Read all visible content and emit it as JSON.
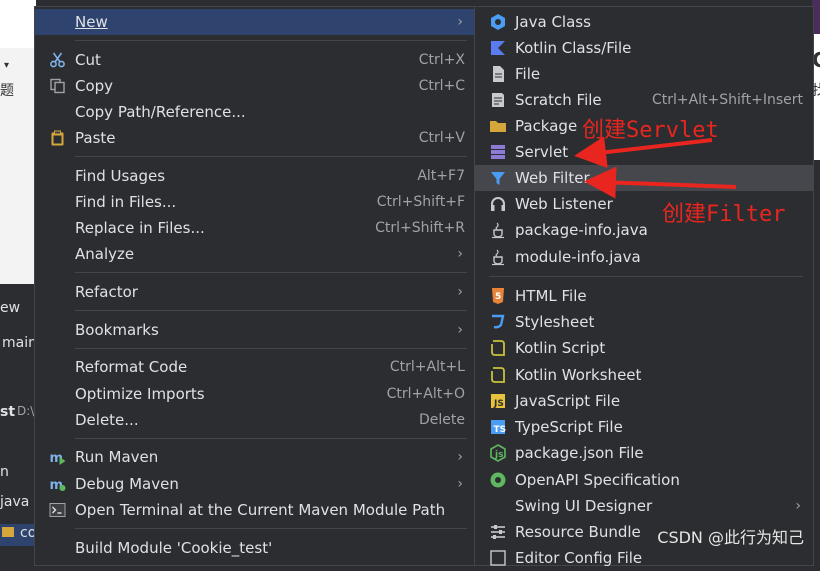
{
  "background": {
    "left_texts": [
      "题",
      "ew",
      "main",
      "st",
      "D:\\",
      "n",
      "java",
      "co"
    ],
    "right_texts": [
      "C",
      "找"
    ]
  },
  "menu": {
    "items": [
      {
        "label": "New",
        "arrow": "›",
        "icon": "none",
        "highlight": true
      },
      {
        "label": "Cut",
        "shortcut": "Ctrl+X",
        "icon": "scissors-icon"
      },
      {
        "label": "Copy",
        "shortcut": "Ctrl+C",
        "icon": "copy-icon"
      },
      {
        "label": "Copy Path/Reference...",
        "icon": "none"
      },
      {
        "label": "Paste",
        "shortcut": "Ctrl+V",
        "icon": "clipboard-icon"
      },
      {
        "label": "Find Usages",
        "shortcut": "Alt+F7"
      },
      {
        "label": "Find in Files...",
        "shortcut": "Ctrl+Shift+F"
      },
      {
        "label": "Replace in Files...",
        "shortcut": "Ctrl+Shift+R"
      },
      {
        "label": "Analyze",
        "arrow": "›"
      },
      {
        "label": "Refactor",
        "arrow": "›"
      },
      {
        "label": "Bookmarks",
        "arrow": "›"
      },
      {
        "label": "Reformat Code",
        "shortcut": "Ctrl+Alt+L"
      },
      {
        "label": "Optimize Imports",
        "shortcut": "Ctrl+Alt+O"
      },
      {
        "label": "Delete...",
        "shortcut": "Delete"
      },
      {
        "label": "Run Maven",
        "arrow": "›",
        "icon": "maven-run-icon"
      },
      {
        "label": "Debug Maven",
        "arrow": "›",
        "icon": "maven-debug-icon"
      },
      {
        "label": "Open Terminal at the Current Maven Module Path",
        "icon": "terminal-icon"
      },
      {
        "label": "Build Module 'Cookie_test'"
      }
    ]
  },
  "submenu": {
    "items": [
      {
        "label": "Java Class",
        "icon": "java-class-icon"
      },
      {
        "label": "Kotlin Class/File",
        "icon": "kotlin-icon"
      },
      {
        "label": "File",
        "icon": "file-icon"
      },
      {
        "label": "Scratch File",
        "shortcut": "Ctrl+Alt+Shift+Insert",
        "icon": "scratch-file-icon"
      },
      {
        "label": "Package",
        "icon": "folder-icon"
      },
      {
        "label": "Servlet",
        "icon": "servlet-icon"
      },
      {
        "label": "Web Filter",
        "icon": "filter-icon",
        "highlight": true
      },
      {
        "label": "Web Listener",
        "icon": "headphones-icon"
      },
      {
        "label": "package-info.java",
        "icon": "java-cup-icon"
      },
      {
        "label": "module-info.java",
        "icon": "java-cup-icon"
      },
      {
        "label": "HTML File",
        "icon": "html5-icon"
      },
      {
        "label": "Stylesheet",
        "icon": "css3-icon"
      },
      {
        "label": "Kotlin Script",
        "icon": "kotlin-script-icon"
      },
      {
        "label": "Kotlin Worksheet",
        "icon": "kotlin-worksheet-icon"
      },
      {
        "label": "JavaScript File",
        "icon": "javascript-icon"
      },
      {
        "label": "TypeScript File",
        "icon": "typescript-icon"
      },
      {
        "label": "package.json File",
        "icon": "nodejs-icon"
      },
      {
        "label": "OpenAPI Specification",
        "icon": "openapi-icon"
      },
      {
        "label": "Swing UI Designer",
        "arrow": "›"
      },
      {
        "label": "Resource Bundle",
        "icon": "resource-bundle-icon"
      },
      {
        "label": "Editor Config File",
        "icon": "editor-config-icon"
      }
    ]
  },
  "annotations": {
    "servlet": "创建Servlet",
    "filter": "创建Filter"
  },
  "watermark": "CSDN @此行为知己",
  "colors": {
    "menu_bg": "#2b2d30",
    "selection": "#2e436e",
    "hover": "#45474d",
    "annotation_red": "#e8261f"
  }
}
